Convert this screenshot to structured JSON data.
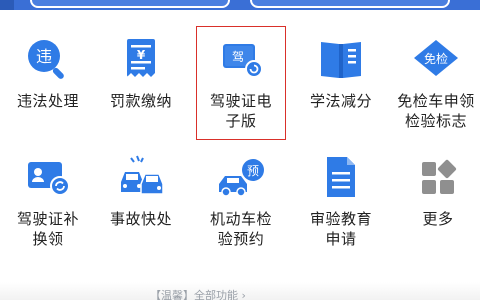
{
  "colors": {
    "banner": "#3a6fd6",
    "icon_blue": "#2f7be6",
    "icon_light": "#cfe2fb",
    "icon_gray": "#8f8f8f",
    "highlight": "#d9302a"
  },
  "row1": [
    {
      "label": "违法处理",
      "icon": "magnifier-violation-icon",
      "glyph": "违"
    },
    {
      "label": "罚款缴纳",
      "icon": "fine-receipt-icon",
      "glyph": "¥"
    },
    {
      "label": "驾驶证电子版",
      "icon": "driver-license-card-icon",
      "glyph": "驾"
    },
    {
      "label": "学法减分",
      "icon": "open-book-icon",
      "glyph": ""
    },
    {
      "label": "免检车申领检验标志",
      "icon": "inspection-exempt-badge-icon",
      "glyph": "免检"
    }
  ],
  "row2": [
    {
      "label": "驾驶证补换领",
      "icon": "id-card-refresh-icon",
      "glyph": ""
    },
    {
      "label": "事故快处",
      "icon": "car-accident-icon",
      "glyph": ""
    },
    {
      "label": "机动车检验预约",
      "icon": "car-booking-icon",
      "glyph": "预"
    },
    {
      "label": "审验教育申请",
      "icon": "document-icon",
      "glyph": ""
    },
    {
      "label": "更多",
      "icon": "more-grid-icon",
      "glyph": ""
    }
  ],
  "labels": {
    "r1c1": "违法处理",
    "r1c2": "罚款缴纳",
    "r1c3a": "驾驶证电",
    "r1c3b": "子版",
    "r1c4": "学法减分",
    "r1c5a": "免检车申领",
    "r1c5b": "检验标志",
    "r2c1a": "驾驶证补",
    "r2c1b": "换领",
    "r2c2": "事故快处",
    "r2c3a": "机动车检",
    "r2c3b": "验预约",
    "r2c4a": "审验教育",
    "r2c4b": "申请",
    "r2c5": "更多"
  },
  "glyphs": {
    "violation": "违",
    "fine": "¥",
    "license": "驾",
    "exempt": "免检",
    "booking": "预"
  },
  "footer_text": "【温馨】全部功能 ›"
}
